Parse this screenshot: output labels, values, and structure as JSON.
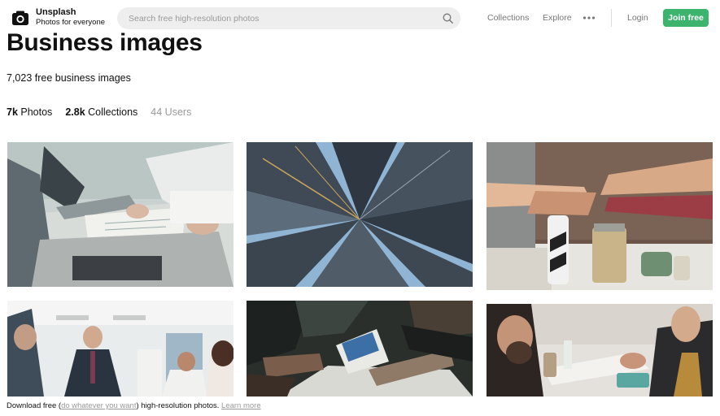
{
  "header": {
    "logo_name": "Unsplash",
    "logo_tagline": "Photos for everyone",
    "search_placeholder": "Search free high-resolution photos",
    "nav": {
      "collections": "Collections",
      "explore": "Explore",
      "login": "Login",
      "join": "Join free"
    },
    "colors": {
      "join_button": "#3cb46e",
      "search_bg": "#eeeeee"
    }
  },
  "main": {
    "title": "Business images",
    "subtitle": "7,023 free business images",
    "tabs": [
      {
        "count": "7k",
        "label": "Photos"
      },
      {
        "count": "2.8k",
        "label": "Collections"
      },
      {
        "count": "44",
        "label": "Users"
      }
    ]
  },
  "photos": [
    {
      "name": "laptop-meeting-notes"
    },
    {
      "name": "skyscrapers-looking-up"
    },
    {
      "name": "team-fist-bump"
    },
    {
      "name": "office-team-standing"
    },
    {
      "name": "hands-laptop-meeting"
    },
    {
      "name": "handshake-cafe"
    }
  ],
  "footer": {
    "prefix": "Download free (",
    "license_link": "do whatever you want",
    "middle": ") high-resolution photos. ",
    "learn_more": "Learn more"
  }
}
